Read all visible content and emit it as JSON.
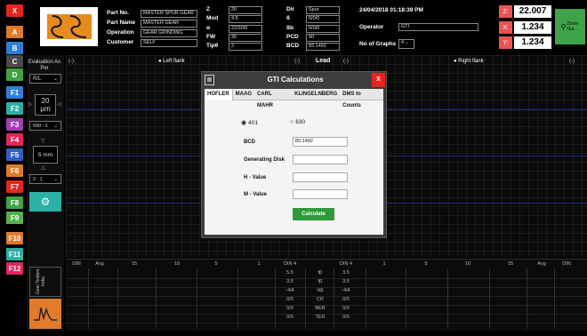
{
  "left_buttons": [
    {
      "label": "X",
      "color": "#e8241e"
    },
    {
      "label": "A",
      "color": "#e07b2c"
    },
    {
      "label": "B",
      "color": "#2f7fd6"
    },
    {
      "label": "C",
      "color": "#4a4a4a"
    },
    {
      "label": "D",
      "color": "#3fa33f"
    },
    {
      "label": "F1",
      "color": "#2f7fd6"
    },
    {
      "label": "F2",
      "color": "#2bb1a5"
    },
    {
      "label": "F3",
      "color": "#a13fb0"
    },
    {
      "label": "F4",
      "color": "#e3245c"
    },
    {
      "label": "F5",
      "color": "#2f5fc4"
    },
    {
      "label": "F6",
      "color": "#e07b2c"
    },
    {
      "label": "F7",
      "color": "#e8241e"
    },
    {
      "label": "F8",
      "color": "#3fa33f"
    },
    {
      "label": "F9",
      "color": "#55b04c"
    },
    {
      "label": "F10",
      "color": "#e07b2c"
    },
    {
      "label": "F11",
      "color": "#2bb1a5"
    },
    {
      "label": "F12",
      "color": "#e3245c"
    }
  ],
  "header": {
    "part_no_label": "Part No.",
    "part_no": "MASTER SPUR GEAR",
    "part_name_label": "Part Name",
    "part_name": "MASTER GEAR",
    "operation_label": "Operation",
    "operation": "GEAR GRINDING",
    "customer_label": "Customer",
    "customer": "SELF",
    "z_label": "Z",
    "z": "20",
    "mod_label": "Mod",
    "mod": "4.5",
    "alpha_label": "α",
    "alpha": "22/30/0",
    "fw_label": "FW",
    "fw": "30",
    "tip_label": "Tipθ",
    "tip": "2",
    "dir_label": "Dir",
    "dir": "Spur",
    "b_label": "ß",
    "b": "0/0/0",
    "bb_label": "ßb",
    "bb": "0/0/0",
    "pcd_label": "PCD",
    "pcd": "90",
    "bcd_label": "BCD",
    "bcd": "83.1492",
    "datetime": "24/04/2018 01:18:39 PM",
    "operator_label": "Operator",
    "operator": "GTI",
    "graphs_label": "No of Graphs",
    "graphs": "4",
    "z_read_label": "Z:",
    "z_read": "22.007",
    "x_read_label": "X:",
    "x_read": "1.234",
    "y_read_label": "Y:",
    "y_read": "1.234",
    "zoom_label": "Zoom Out"
  },
  "panel": {
    "eval_label": "Evaluation As Per",
    "eval_value": "R/L",
    "um_value": "20",
    "um_unit": "µm",
    "ratio1": "500 : 1",
    "mm_value": "5 mm",
    "ratio2": "2 : 1",
    "brand": "Gear Testers India"
  },
  "graph_header": {
    "left_minus": "(-)",
    "left_flank": "Left flank",
    "lead_minus": "(-)",
    "lead": "Lead",
    "lead_plus": "(-)",
    "right_flank": "Right flank",
    "right_minus": "(-)"
  },
  "dialog": {
    "title": "GTI Calculations",
    "close": "X",
    "tabs": [
      "HOFLER",
      "MAAG",
      "CARL MAHR",
      "KLINGELNBERG",
      "DMS to Counts"
    ],
    "radio1": "401",
    "radio2": "630",
    "bcd_label": "BCD",
    "bcd_value": "83.1492",
    "gen_disk_label": "Generating Disk",
    "gen_disk_value": "",
    "h_label": "H - Value",
    "h_value": "",
    "m_label": "M - Value",
    "m_value": "",
    "calc_label": "Calculate"
  },
  "table": {
    "headers": [
      "DIN",
      "Avg",
      "15",
      "10",
      "5",
      "1",
      "DIN 4",
      "",
      "DIN 4",
      "1",
      "5",
      "10",
      "15",
      "Avg",
      "DIN"
    ],
    "rows": [
      {
        "l": "5.5",
        "m": "fβ",
        "r": "3.5"
      },
      {
        "l": "3.5",
        "m": "fβ",
        "r": "3.5"
      },
      {
        "l": "-4/4",
        "m": "Hβ",
        "r": "-4/4"
      },
      {
        "l": "0/0",
        "m": "CR",
        "r": "0/0"
      },
      {
        "l": "0/0",
        "m": "BER",
        "r": "0/0"
      },
      {
        "l": "0/0",
        "m": "TER",
        "r": "0/0"
      }
    ]
  }
}
